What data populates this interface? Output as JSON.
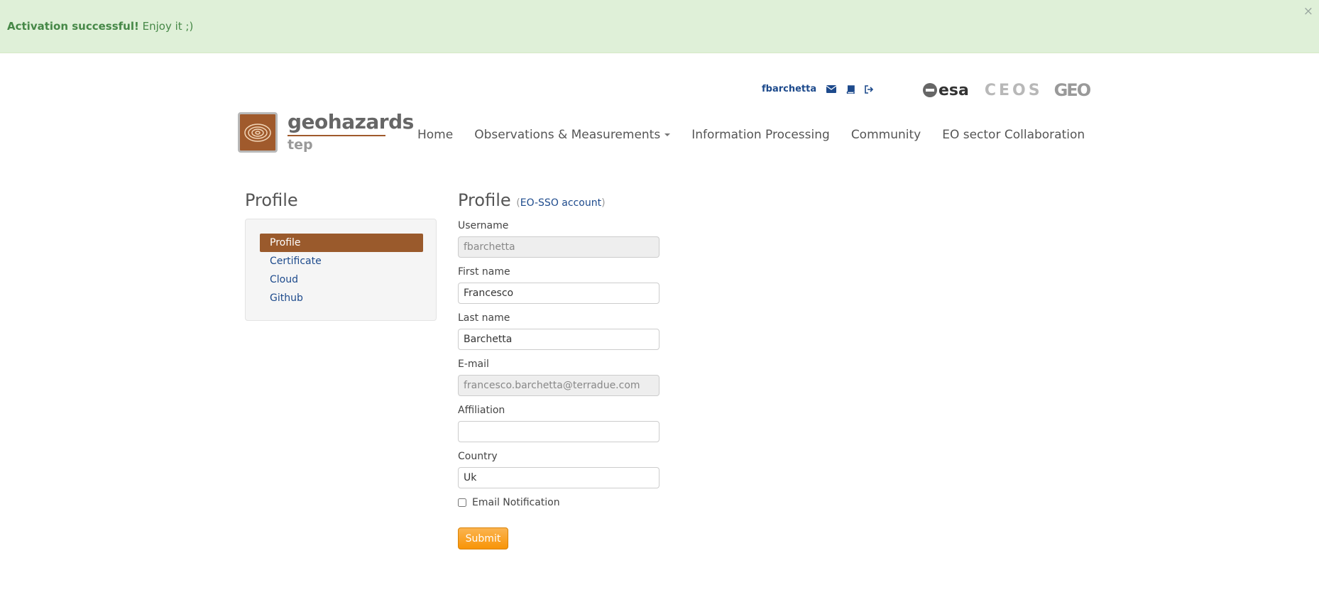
{
  "alert": {
    "strong": "Activation successful!",
    "text": " Enjoy it ;)",
    "close": "×",
    "color": "#dff0d8"
  },
  "userbar": {
    "username": "fbarchetta",
    "icons": [
      "envelope-icon",
      "book-icon",
      "sign-out-icon"
    ]
  },
  "partners": {
    "esa": "esa",
    "ceos": "CEOS",
    "geo": "GEO"
  },
  "logo": {
    "title": "geohazards",
    "subtitle": "tep",
    "brand_color": "#a05a2c"
  },
  "nav": {
    "items": [
      "Home",
      "Observations & Measurements",
      "Information Processing",
      "Community",
      "EO sector Collaboration"
    ]
  },
  "sidebar": {
    "title": "Profile",
    "items": [
      "Profile",
      "Certificate",
      "Cloud",
      "Github"
    ],
    "active_index": 0
  },
  "form": {
    "title": "Profile",
    "title_open": "(",
    "title_link": "EO-SSO account",
    "title_close": ")",
    "fields": [
      {
        "label": "Username",
        "value": "fbarchetta",
        "disabled": true
      },
      {
        "label": "First name",
        "value": "Francesco",
        "disabled": false
      },
      {
        "label": "Last name",
        "value": "Barchetta",
        "disabled": false
      },
      {
        "label": "E-mail",
        "value": "francesco.barchetta@terradue.com",
        "disabled": true
      },
      {
        "label": "Affiliation",
        "value": "",
        "disabled": false
      },
      {
        "label": "Country",
        "value": "Uk",
        "disabled": false
      }
    ],
    "checkbox_label": "Email Notification",
    "checkbox_checked": false,
    "submit_label": "Submit",
    "submit_color": "#f89406"
  }
}
